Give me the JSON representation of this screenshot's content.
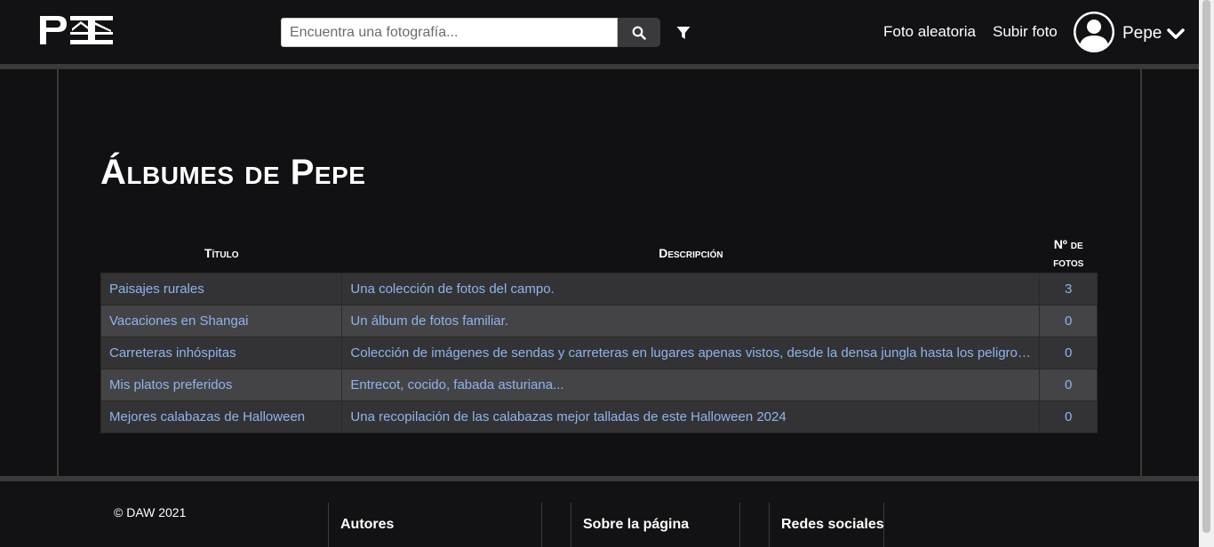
{
  "header": {
    "logo_text": "PI",
    "search": {
      "placeholder": "Encuentra una fotografía...",
      "value": ""
    },
    "nav": {
      "random_photo": "Foto aleatoria",
      "upload_photo": "Subir foto"
    },
    "user": {
      "name": "Pepe"
    }
  },
  "main": {
    "title": "Álbumes de Pepe",
    "table": {
      "headers": {
        "title": "Título",
        "description": "Descripción",
        "count": "Nº de fotos"
      },
      "rows": [
        {
          "title": "Paisajes rurales",
          "description": "Una colección de fotos del campo.",
          "count": "3"
        },
        {
          "title": "Vacaciones en Shangai",
          "description": "Un álbum de fotos familiar.",
          "count": "0"
        },
        {
          "title": "Carreteras inhóspitas",
          "description": "Colección de imágenes de sendas y carreteras en lugares apenas vistos, desde la densa jungla hasta los peligroso…",
          "count": "0"
        },
        {
          "title": "Mis platos preferidos",
          "description": "Entrecot, cocido, fabada asturiana...",
          "count": "0"
        },
        {
          "title": "Mejores calabazas de Halloween",
          "description": "Una recopilación de las calabazas mejor talladas de este Halloween 2024",
          "count": "0"
        }
      ]
    }
  },
  "footer": {
    "copyright": "© DAW 2021",
    "columns": [
      "Autores",
      "Sobre la página",
      "Redes sociales"
    ]
  },
  "colors": {
    "background": "#111012",
    "link": "#8fb4ef",
    "row_odd": "#333335",
    "row_even": "#444446",
    "rule": "#3a3a3a"
  }
}
